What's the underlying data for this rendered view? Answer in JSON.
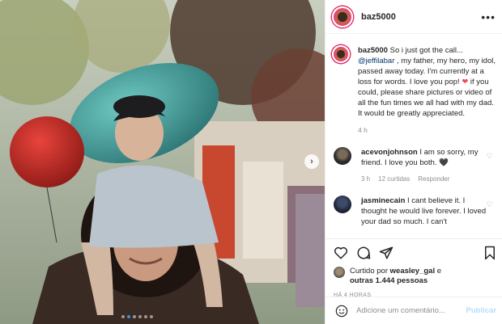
{
  "post": {
    "author": "baz5000",
    "more_icon": "more-horizontal-icon",
    "caption": {
      "username": "baz5000",
      "text_before_mention": "So i just got the call... ",
      "mention": "@jeffilabar",
      "text_after_mention": " , my father, my hero, my idol, passed away today. I'm currently at a loss for words. I love you pop! ",
      "heart": "❤",
      "text_after_heart": " if you could, please share pictures or video of all the fun times we all had with my dad. It would be greatly appreciated.",
      "age": "4 h"
    },
    "comments": [
      {
        "username": "acevonjohnson",
        "text": "I am so sorry, my friend. I love you both. 🖤",
        "age": "3 h",
        "likes": "12 curtidas",
        "reply": "Responder"
      },
      {
        "username": "jasminecain",
        "text": "I cant believe it. I thought he would live forever. I loved your dad so much. I can't",
        "age": "",
        "likes": "",
        "reply": ""
      }
    ],
    "liked_by": {
      "prefix": "Curtido por ",
      "user": "weasley_gal",
      "middle": " e",
      "others": "outras 1.444 pessoas"
    },
    "timestamp": "HÁ 4 HORAS",
    "comment_input": {
      "placeholder": "Adicione um comentário...",
      "publish": "Publicar"
    }
  },
  "photo": {
    "nav_next": "›",
    "carousel_dots": 6,
    "active_dot": 1
  },
  "colors": {
    "accent": "#0095f6",
    "link": "#00376b",
    "heart": "#ed4956",
    "muted": "#8e8e8e"
  }
}
